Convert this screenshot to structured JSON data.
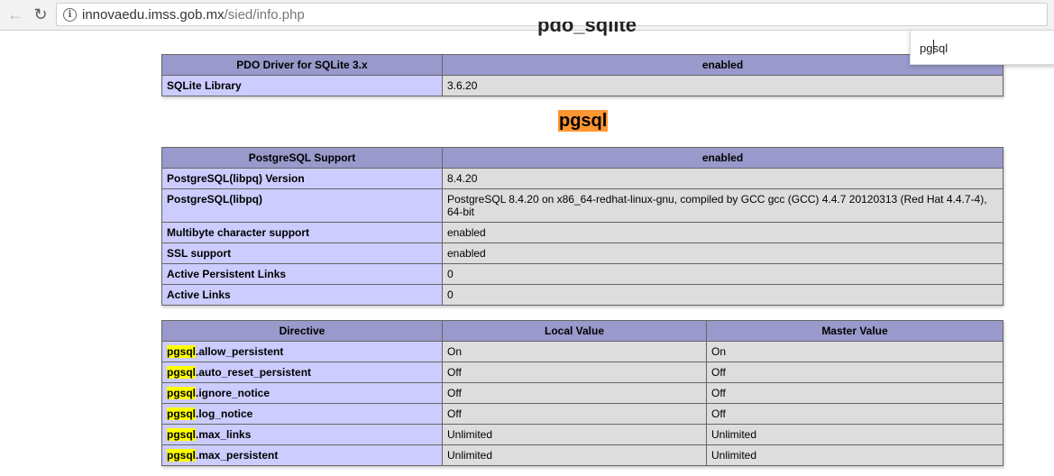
{
  "browser": {
    "back_glyph": "←",
    "reload_glyph": "↻",
    "info_glyph": "i",
    "url_host": "innovaedu.imss.gob.mx",
    "url_path": "/sied/info.php"
  },
  "find": {
    "query": "pgsql"
  },
  "page": {
    "partial_heading": "pdo_sqlite",
    "pdo_table": {
      "header": [
        "PDO Driver for SQLite 3.x",
        "enabled"
      ],
      "rows": [
        [
          "SQLite Library",
          "3.6.20"
        ]
      ]
    },
    "section_title": "pgsql",
    "pgsql_table": {
      "header": [
        "PostgreSQL Support",
        "enabled"
      ],
      "rows": [
        [
          "PostgreSQL(libpq) Version",
          "8.4.20"
        ],
        [
          "PostgreSQL(libpq)",
          "PostgreSQL 8.4.20 on x86_64-redhat-linux-gnu, compiled by GCC gcc (GCC) 4.4.7 20120313 (Red Hat 4.4.7-4), 64-bit"
        ],
        [
          "Multibyte character support",
          "enabled"
        ],
        [
          "SSL support",
          "enabled"
        ],
        [
          "Active Persistent Links",
          "0"
        ],
        [
          "Active Links",
          "0"
        ]
      ]
    },
    "directive_table": {
      "headers": [
        "Directive",
        "Local Value",
        "Master Value"
      ],
      "prefix": "pgsql",
      "rows": [
        {
          "suffix": ".allow_persistent",
          "local": "On",
          "master": "On"
        },
        {
          "suffix": ".auto_reset_persistent",
          "local": "Off",
          "master": "Off"
        },
        {
          "suffix": ".ignore_notice",
          "local": "Off",
          "master": "Off"
        },
        {
          "suffix": ".log_notice",
          "local": "Off",
          "master": "Off"
        },
        {
          "suffix": ".max_links",
          "local": "Unlimited",
          "master": "Unlimited"
        },
        {
          "suffix": ".max_persistent",
          "local": "Unlimited",
          "master": "Unlimited"
        }
      ]
    }
  },
  "colors": {
    "header_bg": "#9999cc",
    "label_bg": "#ccccff",
    "value_bg": "#dddddd",
    "search_highlight": "#ffff00",
    "active_match": "#ff9632"
  }
}
